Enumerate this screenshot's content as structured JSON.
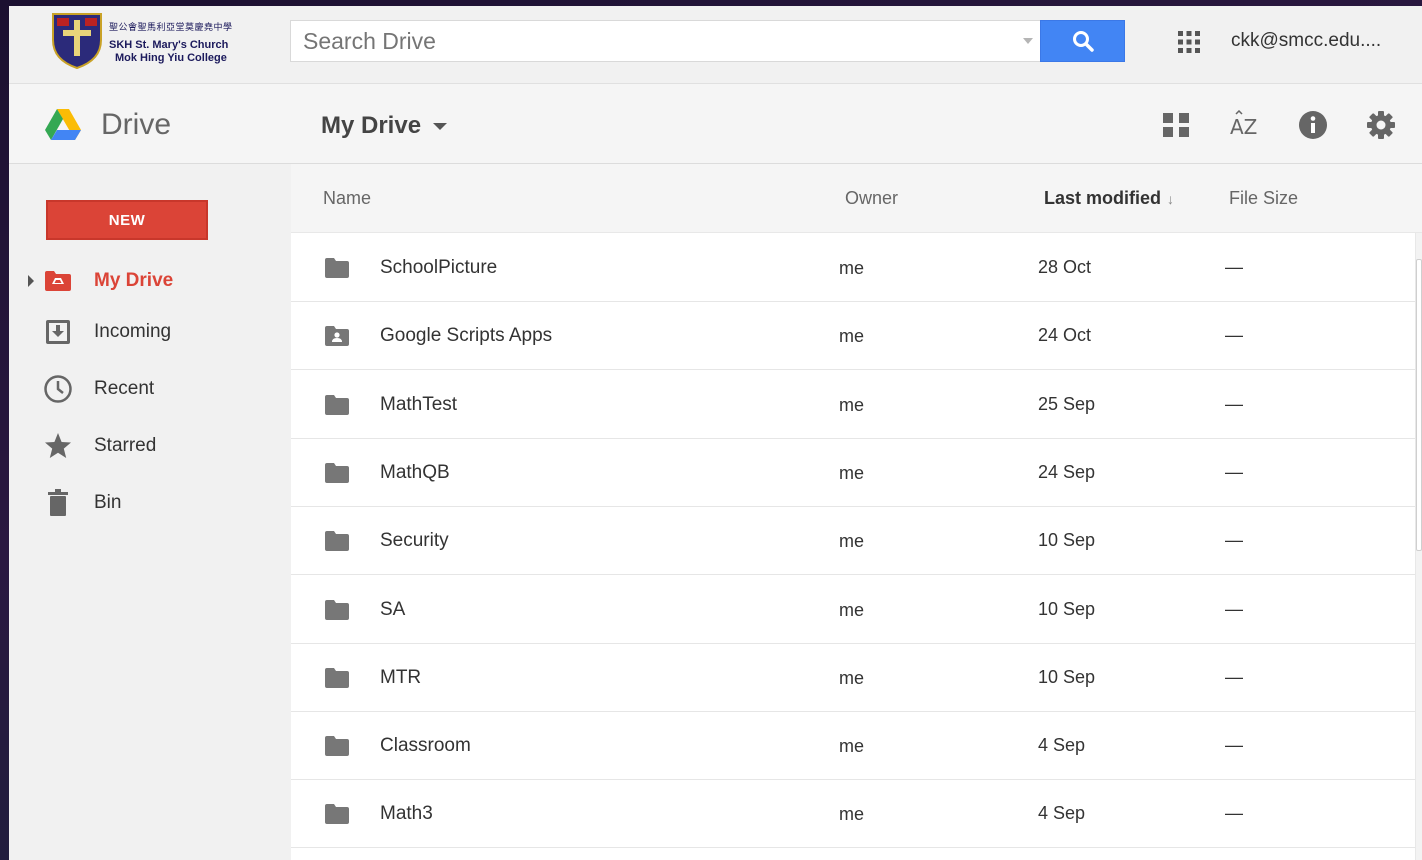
{
  "header": {
    "school_name_chinese": "聖公會聖馬利亞堂莫慶堯中學",
    "school_name_line1": "SKH St. Mary's Church",
    "school_name_line2": "Mok Hing Yiu College",
    "search_placeholder": "Search Drive",
    "account": "ckk@smcc.edu...."
  },
  "subheader": {
    "app_name": "Drive",
    "location": "My Drive"
  },
  "sidebar": {
    "new_button": "NEW",
    "items": [
      {
        "label": "My Drive",
        "icon": "my-drive-icon",
        "active": true
      },
      {
        "label": "Incoming",
        "icon": "incoming-icon",
        "active": false
      },
      {
        "label": "Recent",
        "icon": "clock-icon",
        "active": false
      },
      {
        "label": "Starred",
        "icon": "star-icon",
        "active": false
      },
      {
        "label": "Bin",
        "icon": "trash-icon",
        "active": false
      }
    ]
  },
  "file_list": {
    "columns": {
      "name": "Name",
      "owner": "Owner",
      "modified": "Last modified",
      "modified_sort_arrow": "↓",
      "size": "File Size"
    },
    "rows": [
      {
        "name": "SchoolPicture",
        "owner": "me",
        "modified": "28 Oct",
        "size": "—",
        "type": "folder"
      },
      {
        "name": "Google Scripts Apps",
        "owner": "me",
        "modified": "24 Oct",
        "size": "—",
        "type": "shared-folder"
      },
      {
        "name": "MathTest",
        "owner": "me",
        "modified": "25 Sep",
        "size": "—",
        "type": "folder"
      },
      {
        "name": "MathQB",
        "owner": "me",
        "modified": "24 Sep",
        "size": "—",
        "type": "folder"
      },
      {
        "name": "Security",
        "owner": "me",
        "modified": "10 Sep",
        "size": "—",
        "type": "folder"
      },
      {
        "name": "SA",
        "owner": "me",
        "modified": "10 Sep",
        "size": "—",
        "type": "folder"
      },
      {
        "name": "MTR",
        "owner": "me",
        "modified": "10 Sep",
        "size": "—",
        "type": "folder"
      },
      {
        "name": "Classroom",
        "owner": "me",
        "modified": "4 Sep",
        "size": "—",
        "type": "folder"
      },
      {
        "name": "Math3",
        "owner": "me",
        "modified": "4 Sep",
        "size": "—",
        "type": "folder"
      }
    ]
  },
  "colors": {
    "accent_red": "#db4437",
    "search_blue": "#4285f4"
  }
}
